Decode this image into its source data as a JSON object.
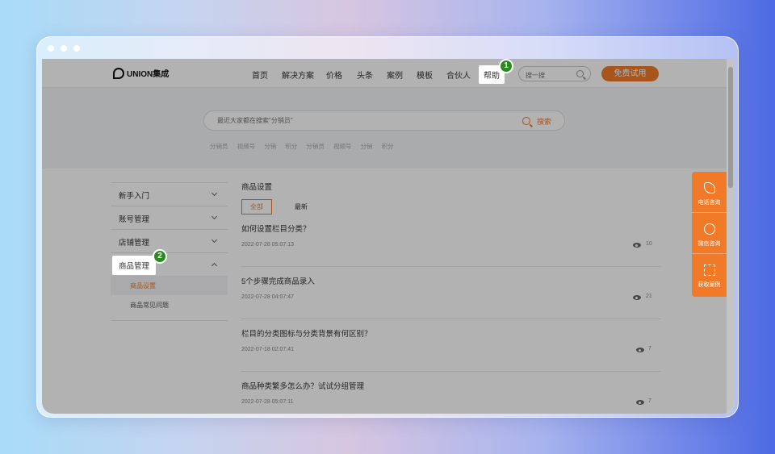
{
  "window": {
    "accent": "#f07a28",
    "overlay_color": "rgba(0,0,0,0.30)",
    "badge_color": "#2a8a1e"
  },
  "brand": {
    "logo_text": "UNION集成"
  },
  "nav": {
    "items": [
      "首页",
      "解决方案",
      "价格",
      "头条",
      "案例",
      "模板",
      "合伙人"
    ],
    "help": "帮助"
  },
  "top_search": {
    "placeholder": "搜一搜"
  },
  "trial_button": "免费试用",
  "hero": {
    "search_placeholder": "最近大家都在搜索\"分销员\"",
    "search_button": "搜索",
    "tags": [
      "分销员",
      "视频号",
      "分销",
      "积分",
      "分销员",
      "视频号",
      "分销",
      "积分"
    ]
  },
  "sidebar": {
    "categories": [
      "新手入门",
      "账号管理",
      "店铺管理"
    ],
    "active_category": "商品管理",
    "sub_items": [
      "商品设置",
      "商品常见问题"
    ]
  },
  "content": {
    "section_title": "商品设置",
    "tabs": [
      "全部",
      "最新"
    ],
    "articles": [
      {
        "title": "如何设置栏目分类？",
        "date": "2022-07-28 05:07:13",
        "views": "10"
      },
      {
        "title": "5个步骤完成商品录入",
        "date": "2022-07-28 04:07:47",
        "views": "21"
      },
      {
        "title": "栏目的分类图标与分类背景有何区别？",
        "date": "2022-07-18 02:07:41",
        "views": "7"
      },
      {
        "title": "商品种类繁多怎么办？试试分组管理",
        "date": "2022-07-28 05:07:11",
        "views": "7"
      }
    ]
  },
  "contact_panel": {
    "items": [
      {
        "label": "电话咨询",
        "icon": "phone-icon"
      },
      {
        "label": "微信咨询",
        "icon": "wechat-icon"
      },
      {
        "label": "获取案例",
        "icon": "qr-code-icon"
      }
    ]
  },
  "annotations": {
    "badge_1": "1",
    "badge_2": "2"
  }
}
